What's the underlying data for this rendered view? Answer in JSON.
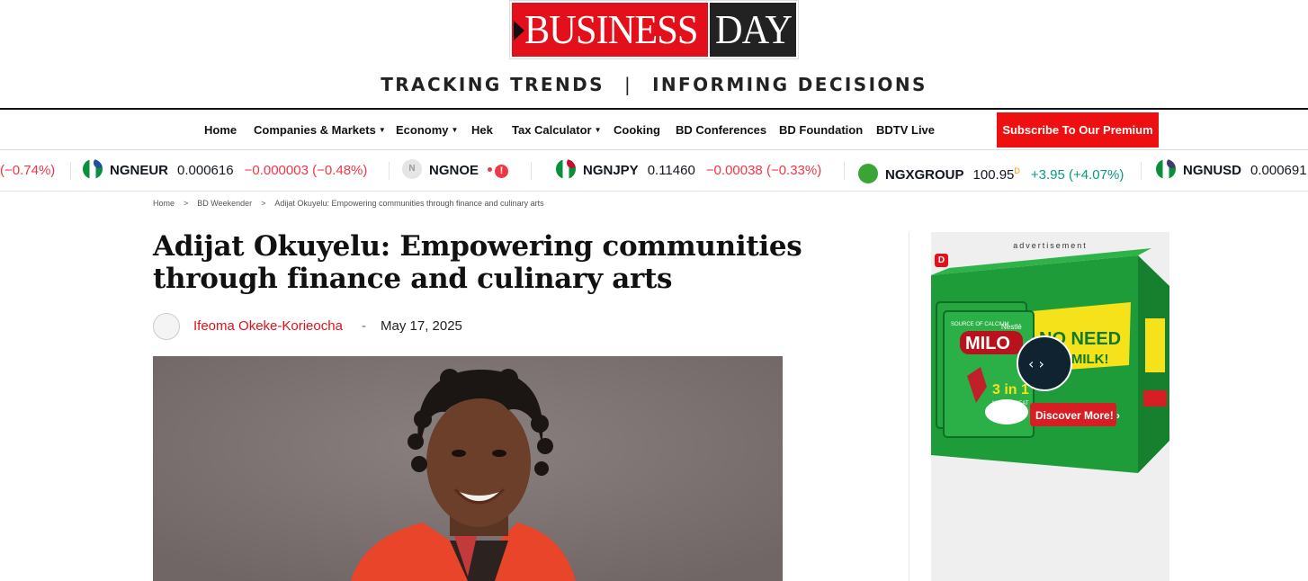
{
  "header": {
    "logo_red_word": "BUSINESS",
    "logo_dark_word": "DAY",
    "tagline_left": "TRACKING TRENDS",
    "tagline_sep": "|",
    "tagline_right": "INFORMING DECISIONS"
  },
  "nav": {
    "items": [
      {
        "label": "Home"
      },
      {
        "label": "Companies & Markets"
      },
      {
        "label": "Economy"
      },
      {
        "label": "Hek"
      },
      {
        "label": "Tax Calculator"
      },
      {
        "label": "Cooking"
      },
      {
        "label": "BD Conferences"
      },
      {
        "label": "BD Foundation"
      },
      {
        "label": "BDTV Live"
      }
    ],
    "subscribe_label": "Subscribe To Our Premium"
  },
  "ticker": {
    "items": [
      {
        "change": "(−0.74%)"
      },
      {
        "symbol": "NGNEUR",
        "value": "0.000616",
        "change": "−0.000003 (−0.48%)"
      },
      {
        "symbol": "NGNOE",
        "badge": "N",
        "alert": "!"
      },
      {
        "symbol": "NGNJPY",
        "value": "0.11460",
        "change": "−0.00038 (−0.33%)"
      },
      {
        "symbol": "NGXGROUP",
        "value": "100.95",
        "value_suffix": "D",
        "change": "+3.95 (+4.07%)"
      },
      {
        "symbol": "NGNUSD",
        "value": "0.000691"
      }
    ],
    "colors": {
      "negative": "#f23645",
      "positive": "#089981"
    }
  },
  "breadcrumb": {
    "items": [
      "Home",
      "BD Weekender",
      "Adijat Okuyelu: Empowering communities through finance and culinary arts"
    ],
    "separator": ">"
  },
  "article": {
    "title": "Adijat Okuyelu: Empowering communities through finance and culinary arts",
    "author": "Ifeoma Okeke-Korieocha",
    "byline_sep": "-",
    "date": "May 17, 2025"
  },
  "ad": {
    "label": "advertisement",
    "badge": "D",
    "brand_top": "Nestlé",
    "brand": "MILO",
    "pack_tag": "SOURCE OF CALCIUM",
    "pack_line": "3 in 1",
    "pack_sub": "MILK & TREAT",
    "headline_1": "NO NEED",
    "headline_2": "FOR MILK!",
    "cta": "Discover More! ›"
  },
  "colors": {
    "brand_red": "#e3101c",
    "subscribe_red": "#ee1010",
    "milo_green": "#1f9c3a"
  }
}
